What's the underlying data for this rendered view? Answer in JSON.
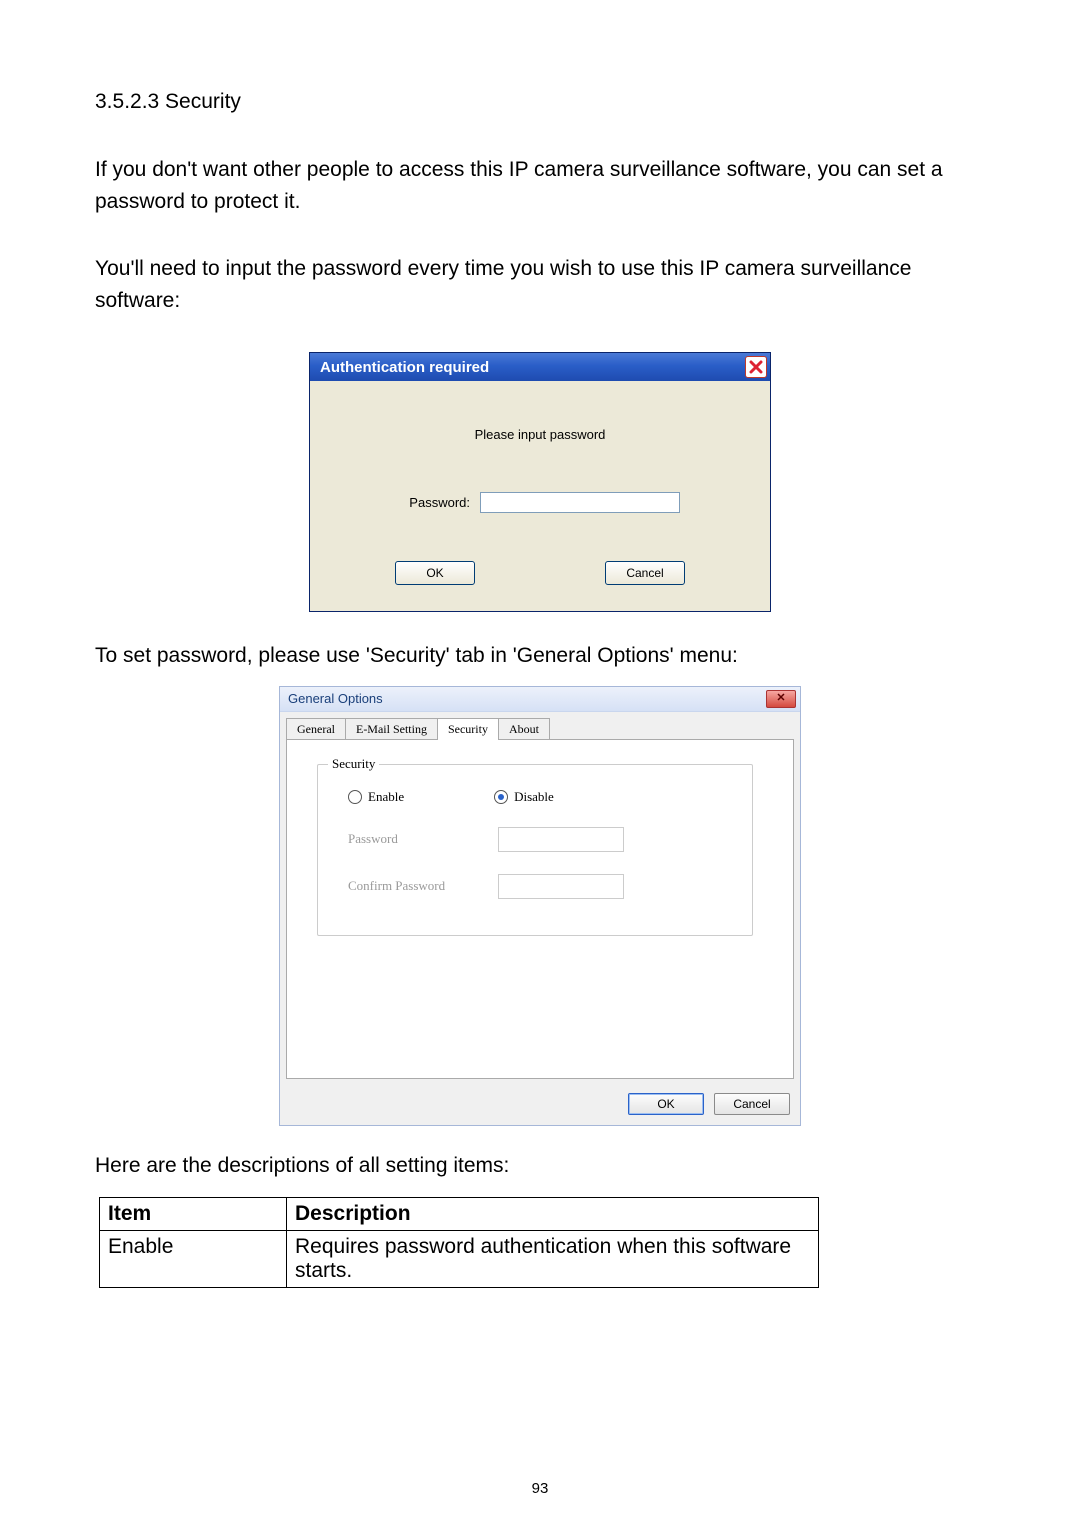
{
  "section_heading": "3.5.2.3 Security",
  "para1": "If you don't want other people to access this IP camera surveillance software, you can set a password to protect it.",
  "para2": "You'll need to input the password every time you wish to use this IP camera surveillance software:",
  "auth_dialog": {
    "title": "Authentication required",
    "prompt": "Please input password",
    "password_label": "Password:",
    "ok": "OK",
    "cancel": "Cancel"
  },
  "para3": "To set password, please use 'Security' tab in 'General Options' menu:",
  "go_dialog": {
    "title": "General Options",
    "tabs": [
      "General",
      "E-Mail Setting",
      "Security",
      "About"
    ],
    "active_tab_index": 2,
    "fieldset_legend": "Security",
    "radio_enable": "Enable",
    "radio_disable": "Disable",
    "selected_radio": "Disable",
    "password_label": "Password",
    "confirm_label": "Confirm Password",
    "ok": "OK",
    "cancel": "Cancel"
  },
  "para4": "Here are the descriptions of all setting items:",
  "table": {
    "head_item": "Item",
    "head_desc": "Description",
    "rows": [
      {
        "item": "Enable",
        "desc": "Requires password authentication when this software starts."
      }
    ]
  },
  "page_number": "93"
}
